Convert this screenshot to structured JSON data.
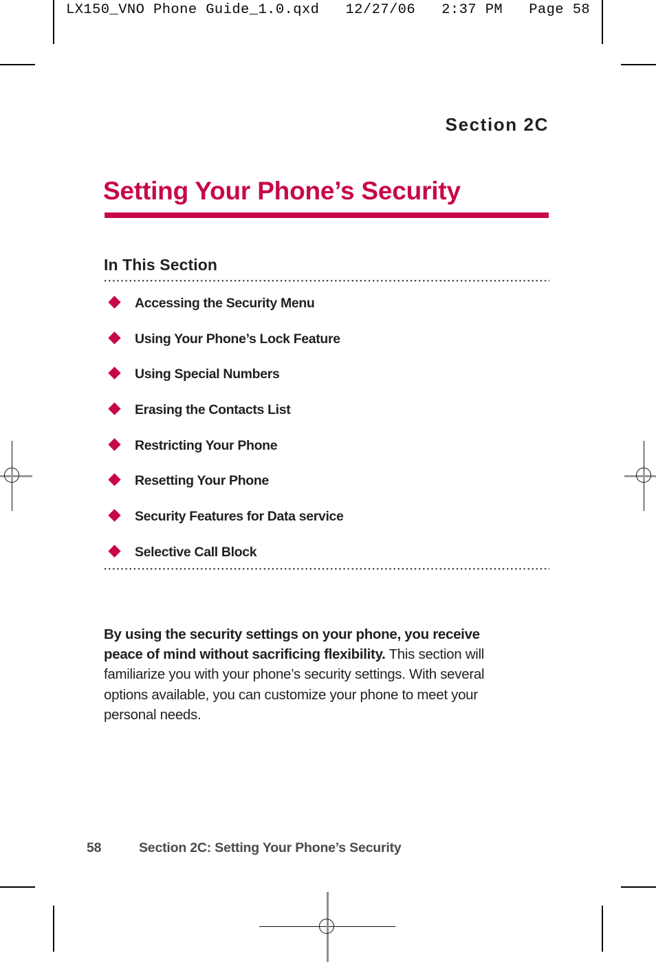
{
  "print_header": {
    "text": "LX150_VNO Phone Guide_1.0.qxd   12/27/06   2:37 PM   Page 58"
  },
  "colors": {
    "accent": "#C8074B",
    "text": "#231F20",
    "footer_text": "#4A4A4A",
    "rule_dots": "#3A3A3A"
  },
  "page": {
    "section_kicker": "Section 2C",
    "title": "Setting Your Phone’s Security",
    "in_this_section_heading": "In This Section",
    "toc_items": [
      {
        "label": "Accessing the Security Menu"
      },
      {
        "label": "Using Your Phone’s Lock Feature"
      },
      {
        "label": "Using Special Numbers"
      },
      {
        "label": "Erasing the Contacts List"
      },
      {
        "label": "Restricting Your Phone"
      },
      {
        "label": "Resetting Your Phone"
      },
      {
        "label": "Security Features for Data service"
      },
      {
        "label": "Selective Call Block"
      }
    ],
    "intro": {
      "bold_lead": "By using the security settings on your phone, you receive peace of mind without sacrificing flexibility.",
      "body": " This section will familiarize you with your phone’s security settings. With several options available, you can customize your phone to meet your personal needs."
    },
    "footer": {
      "page_number": "58",
      "running_title": "Section 2C: Setting Your Phone’s Security"
    }
  }
}
